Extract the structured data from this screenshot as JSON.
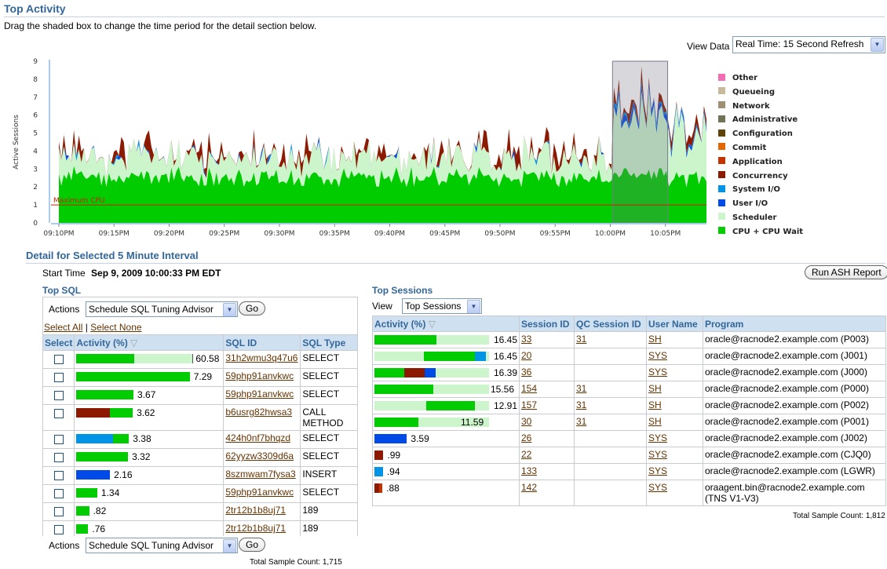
{
  "page": {
    "title": "Top Activity",
    "instructions": "Drag the shaded box to change the time period for the detail section below.",
    "view_data_label": "View Data",
    "view_data_value": "Real Time: 15 Second Refresh"
  },
  "chart_data": {
    "type": "area",
    "title": "",
    "ylabel": "Active Sessions",
    "ylim": [
      0,
      9
    ],
    "yticks": [
      "0",
      "1",
      "2",
      "3",
      "4",
      "5",
      "6",
      "7",
      "8",
      "9"
    ],
    "xticks": [
      "09:10PM",
      "09:15PM",
      "09:20PM",
      "09:25PM",
      "09:30PM",
      "09:35PM",
      "09:40PM",
      "09:45PM",
      "09:50PM",
      "09:55PM",
      "10:00PM",
      "10:05PM"
    ],
    "max_cpu_label": "Maximum CPU",
    "max_cpu_value": 1,
    "selection": {
      "start": "10:00PM",
      "end": "10:05PM"
    },
    "legend": [
      {
        "name": "Other",
        "color": "#f06cb3"
      },
      {
        "name": "Queueing",
        "color": "#c7b99a"
      },
      {
        "name": "Network",
        "color": "#9c8f72"
      },
      {
        "name": "Administrative",
        "color": "#717354"
      },
      {
        "name": "Configuration",
        "color": "#5c440b"
      },
      {
        "name": "Commit",
        "color": "#e46800"
      },
      {
        "name": "Application",
        "color": "#c23400"
      },
      {
        "name": "Concurrency",
        "color": "#8b1a00"
      },
      {
        "name": "System I/O",
        "color": "#0094e7"
      },
      {
        "name": "User I/O",
        "color": "#004ae7"
      },
      {
        "name": "Scheduler",
        "color": "#ccf5cc"
      },
      {
        "name": "CPU + CPU Wait",
        "color": "#00cc00"
      }
    ]
  },
  "detail": {
    "title": "Detail for Selected 5 Minute Interval",
    "start_time_label": "Start Time",
    "start_time_value": "Sep 9, 2009 10:00:33 PM EDT",
    "run_ash_button": "Run ASH Report"
  },
  "top_sql": {
    "title": "Top SQL",
    "actions_label": "Actions",
    "action_value": "Schedule SQL Tuning Advisor",
    "go_label": "Go",
    "select_all": "Select All",
    "select_none": "Select None",
    "columns": [
      "Select",
      "Activity (%)",
      "SQL ID",
      "SQL Type"
    ],
    "rows": [
      {
        "activity": "60.58",
        "pct": 60.58,
        "segments": [
          {
            "color": "#00cc00",
            "value": 100
          }
        ],
        "sql_id": "31h2wmu3q47u6",
        "sql_type": "SELECT"
      },
      {
        "activity": "7.29",
        "pct": 7.29,
        "segments": [
          {
            "color": "#00cc00",
            "value": 100
          }
        ],
        "sql_id": "59php91anvkwc",
        "sql_type": "SELECT"
      },
      {
        "activity": "3.67",
        "pct": 3.67,
        "segments": [
          {
            "color": "#00cc00",
            "value": 100
          }
        ],
        "sql_id": "59php91anvkwc",
        "sql_type": "SELECT"
      },
      {
        "activity": "3.62",
        "pct": 3.62,
        "segments": [
          {
            "color": "#8b1a00",
            "value": 60
          },
          {
            "color": "#00cc00",
            "value": 40
          }
        ],
        "sql_id": "b6usrg82hwsa3",
        "sql_type": "CALL METHOD"
      },
      {
        "activity": "3.38",
        "pct": 3.38,
        "segments": [
          {
            "color": "#0094e7",
            "value": 70
          },
          {
            "color": "#00cc00",
            "value": 30
          }
        ],
        "sql_id": "424h0nf7bhqzd",
        "sql_type": "SELECT"
      },
      {
        "activity": "3.32",
        "pct": 3.32,
        "segments": [
          {
            "color": "#00cc00",
            "value": 100
          }
        ],
        "sql_id": "62yyzw3309d6a",
        "sql_type": "SELECT"
      },
      {
        "activity": "2.16",
        "pct": 2.16,
        "segments": [
          {
            "color": "#004ae7",
            "value": 100
          }
        ],
        "sql_id": "8szmwam7fysa3",
        "sql_type": "INSERT"
      },
      {
        "activity": "1.34",
        "pct": 1.34,
        "segments": [
          {
            "color": "#00cc00",
            "value": 100
          }
        ],
        "sql_id": "59php91anvkwc",
        "sql_type": "SELECT"
      },
      {
        "activity": ".82",
        "pct": 0.82,
        "segments": [
          {
            "color": "#00cc00",
            "value": 100
          }
        ],
        "sql_id": "2tr12b1b8uj71",
        "sql_type": "189"
      },
      {
        "activity": ".76",
        "pct": 0.76,
        "segments": [
          {
            "color": "#00cc00",
            "value": 100
          }
        ],
        "sql_id": "2tr12b1b8uj71",
        "sql_type": "189"
      }
    ],
    "total_sample_count": "Total Sample Count: 1,715"
  },
  "top_sessions": {
    "title": "Top Sessions",
    "view_label": "View",
    "view_value": "Top Sessions",
    "columns": [
      "Activity (%)",
      "Session ID",
      "QC Session ID",
      "User Name",
      "Program"
    ],
    "rows": [
      {
        "activity": "16.45",
        "pct": 16.45,
        "segments": [
          {
            "color": "#00cc00",
            "value": 100
          }
        ],
        "session_id": "33",
        "qc_session_id": "31",
        "user": "SH",
        "program": "oracle@racnode2.example.com (P003)"
      },
      {
        "activity": "16.45",
        "pct": 16.45,
        "segments": [
          {
            "color": "#00cc00",
            "value": 82
          },
          {
            "color": "#0094e7",
            "value": 18
          }
        ],
        "session_id": "20",
        "qc_session_id": "",
        "user": "SYS",
        "program": "oracle@racnode2.example.com (J001)"
      },
      {
        "activity": "16.39",
        "pct": 16.39,
        "segments": [
          {
            "color": "#00cc00",
            "value": 48
          },
          {
            "color": "#8b1a00",
            "value": 34
          },
          {
            "color": "#004ae7",
            "value": 18
          }
        ],
        "session_id": "36",
        "qc_session_id": "",
        "user": "SYS",
        "program": "oracle@racnode2.example.com (J000)"
      },
      {
        "activity": "15.56",
        "pct": 15.56,
        "segments": [
          {
            "color": "#00cc00",
            "value": 100
          }
        ],
        "session_id": "154",
        "qc_session_id": "31",
        "user": "SH",
        "program": "oracle@racnode2.example.com (P000)"
      },
      {
        "activity": "12.91",
        "pct": 12.91,
        "segments": [
          {
            "color": "#00cc00",
            "value": 100
          }
        ],
        "session_id": "157",
        "qc_session_id": "31",
        "user": "SH",
        "program": "oracle@racnode2.example.com (P002)"
      },
      {
        "activity": "11.59",
        "pct": 11.59,
        "segments": [
          {
            "color": "#00cc00",
            "value": 100
          }
        ],
        "session_id": "30",
        "qc_session_id": "31",
        "user": "SH",
        "program": "oracle@racnode2.example.com (P001)"
      },
      {
        "activity": "3.59",
        "pct": 3.59,
        "segments": [
          {
            "color": "#004ae7",
            "value": 100
          }
        ],
        "session_id": "26",
        "qc_session_id": "",
        "user": "SYS",
        "program": "oracle@racnode2.example.com (J002)"
      },
      {
        "activity": ".99",
        "pct": 0.99,
        "segments": [
          {
            "color": "#8b1a00",
            "value": 100
          }
        ],
        "session_id": "22",
        "qc_session_id": "",
        "user": "SYS",
        "program": "oracle@racnode2.example.com (CJQ0)"
      },
      {
        "activity": ".94",
        "pct": 0.94,
        "segments": [
          {
            "color": "#0094e7",
            "value": 100
          }
        ],
        "session_id": "133",
        "qc_session_id": "",
        "user": "SYS",
        "program": "oracle@racnode2.example.com (LGWR)"
      },
      {
        "activity": ".88",
        "pct": 0.88,
        "segments": [
          {
            "color": "#8b1a00",
            "value": 60
          },
          {
            "color": "#c23400",
            "value": 40
          }
        ],
        "session_id": "142",
        "qc_session_id": "",
        "user": "SYS",
        "program": "oraagent.bin@racnode2.example.com (TNS V1-V3)"
      }
    ],
    "total_sample_count": "Total Sample Count: 1,812"
  }
}
